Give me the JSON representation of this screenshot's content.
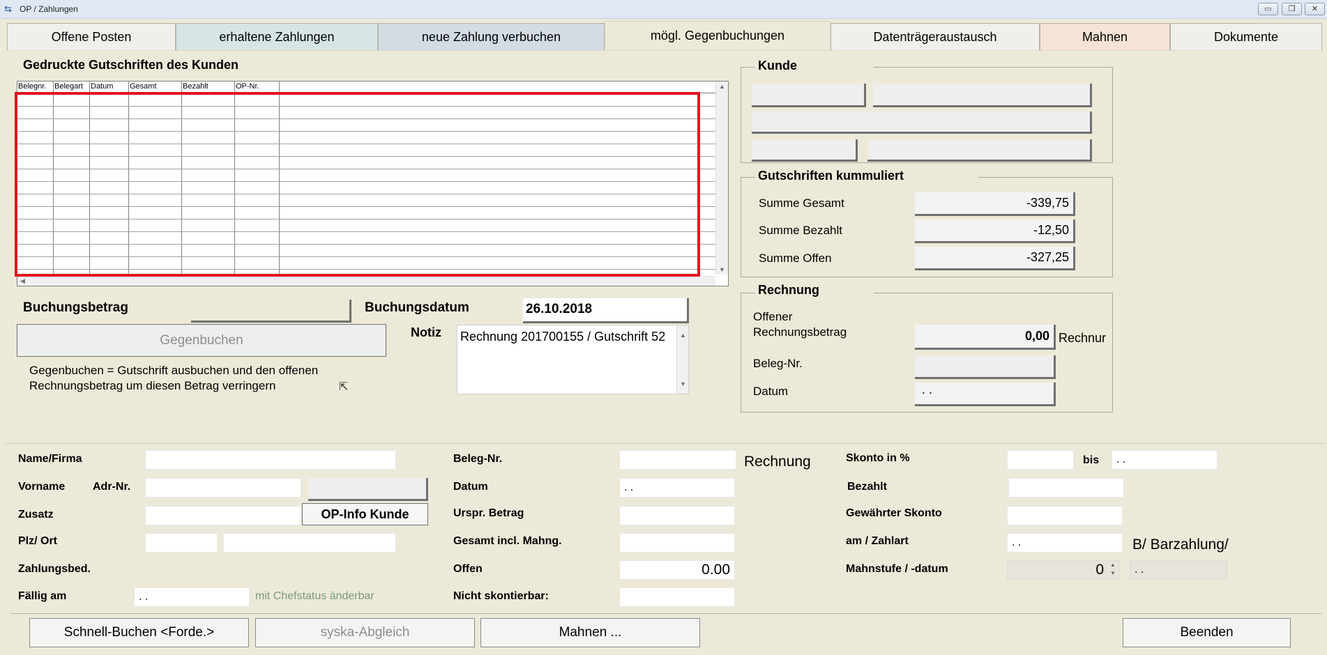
{
  "window": {
    "title": "OP / Zahlungen",
    "controls": [
      "minimize",
      "restore",
      "close"
    ]
  },
  "tabs": [
    {
      "label": "Offene Posten",
      "active": false,
      "color": "#f0efeb"
    },
    {
      "label": "erhaltene Zahlungen",
      "active": false,
      "color": "#d6e6e4"
    },
    {
      "label": "neue Zahlung verbuchen",
      "active": false,
      "color": "#d3dbe3"
    },
    {
      "label": "mögl. Gegenbuchungen",
      "active": true,
      "color": "#ece9d8"
    },
    {
      "label": "Datenträgeraustausch",
      "active": false,
      "color": "#f0efeb"
    },
    {
      "label": "Mahnen",
      "active": false,
      "color": "#f5e4d6"
    },
    {
      "label": "Dokumente",
      "active": false,
      "color": "#f0efeb"
    }
  ],
  "credits": {
    "heading": "Gedruckte Gutschriften des Kunden",
    "columns": [
      "Belegnr.",
      "Belegart",
      "Datum",
      "Gesamt",
      "Bezahlt",
      "OP-Nr."
    ],
    "rows": []
  },
  "booking": {
    "amount_label": "Buchungsbetrag",
    "amount_value": "",
    "date_label": "Buchungsdatum",
    "date_value": "26.10.2018",
    "note_label": "Notiz",
    "note_value": "Rechnung 201700155 / Gutschrift 52",
    "button_label": "Gegenbuchen",
    "hint": "Gegenbuchen = Gutschrift ausbuchen und den offenen Rechnungsbetrag um diesen Betrag verringern"
  },
  "customer_box": {
    "title": "Kunde"
  },
  "credits_total": {
    "title": "Gutschriften kummuliert",
    "rows": [
      {
        "label": "Summe Gesamt",
        "value": "-339,75"
      },
      {
        "label": "Summe Bezahlt",
        "value": "-12,50"
      },
      {
        "label": "Summe Offen",
        "value": "-327,25"
      }
    ]
  },
  "invoice_box": {
    "title": "Rechnung",
    "open_label": "Offener Rechnungsbetrag",
    "open_value": "0,00",
    "open_suffix": "Rechnur",
    "beleg_label": "Beleg-Nr.",
    "beleg_value": "",
    "datum_label": "Datum",
    "datum_value": " .  ."
  },
  "details": {
    "name_label": "Name/Firma",
    "vorname_label": "Vorname",
    "adrnr_label": "Adr-Nr.",
    "zusatz_label": "Zusatz",
    "opinfo_button": "OP-Info Kunde",
    "plz_label": "Plz/ Ort",
    "zahlungsbed_label": "Zahlungsbed.",
    "faellig_label": "Fällig am",
    "faellig_value": " .  .",
    "chefstatus_note": "mit Chefstatus änderbar",
    "beleg_label": "Beleg-Nr.",
    "beleg_type": "Rechnung",
    "datum_label": "Datum",
    "datum_value": " .  .",
    "urspr_label": "Urspr. Betrag",
    "gesamt_label": "Gesamt incl. Mahng.",
    "offen_label": "Offen",
    "offen_value": "0.00",
    "nicht_skont_label": "Nicht skontierbar:",
    "skonto_label": "Skonto in %",
    "bis_label": "bis",
    "bis_value": " .  .",
    "bezahlt_label": "Bezahlt",
    "gew_skonto_label": "Gewährter Skonto",
    "zahlart_label": "am / Zahlart",
    "zahlart_date": " .  .",
    "zahlart_value": "B/  Barzahlung/",
    "mahnstufe_label": "Mahnstufe / -datum",
    "mahnstufe_value": "0",
    "mahndatum_value": " .  ."
  },
  "footer": {
    "schnell": "Schnell-Buchen <Forde.>",
    "syska": "syska-Abgleich",
    "mahnen": "Mahnen ...",
    "beenden": "Beenden"
  }
}
